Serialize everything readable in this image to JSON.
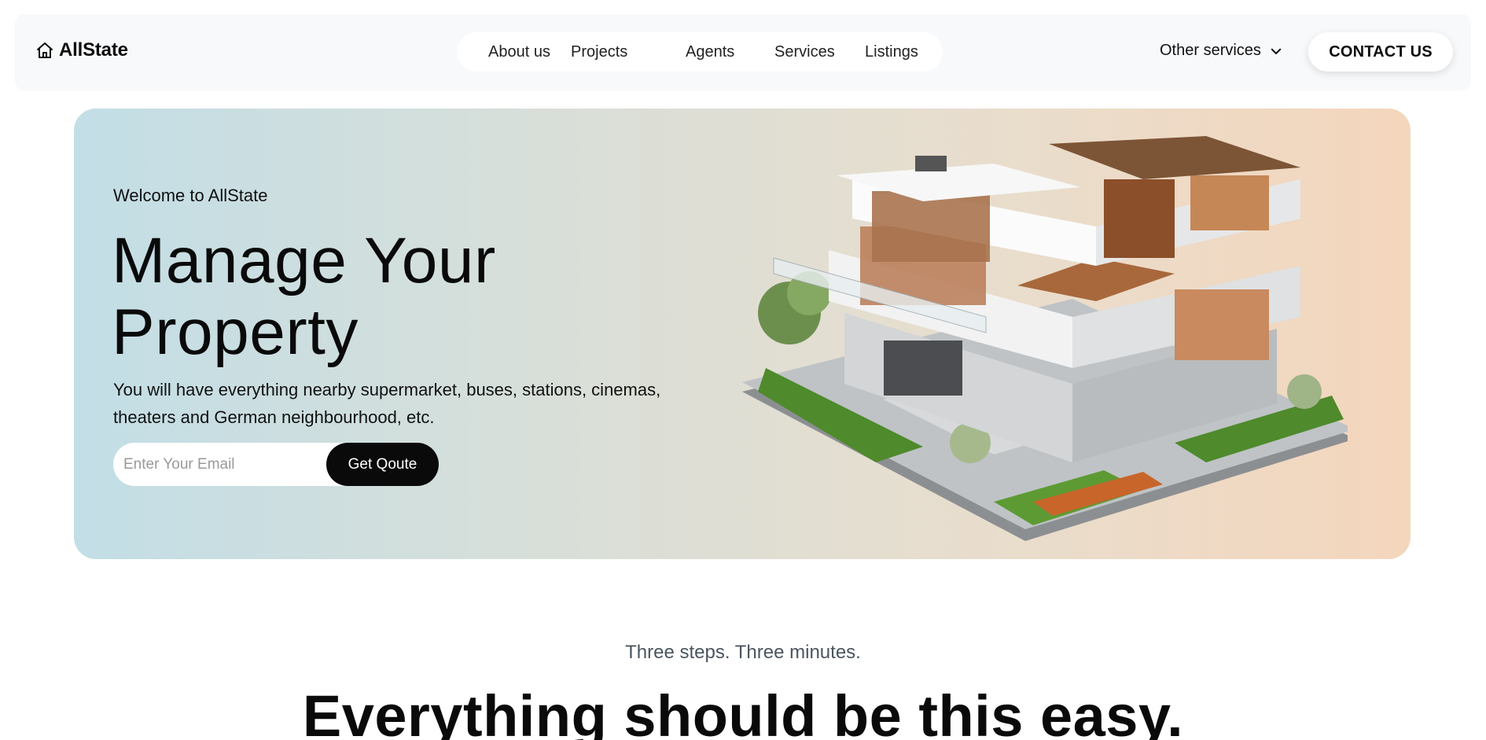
{
  "header": {
    "logo_text": "AllState",
    "logo_icon": "home-icon",
    "nav": [
      "About us",
      "Projects",
      "Agents",
      "Services",
      "Listings"
    ],
    "other_services_label": "Other services",
    "other_services_icon": "chevron-down-icon",
    "contact_label": "CONTACT US"
  },
  "hero": {
    "welcome": "Welcome to AllState",
    "title_line1": "Manage Your",
    "title_line2": "Property",
    "description": "You will have everything nearby supermarket, buses, stations, cinemas, theaters and German neighbourhood, etc.",
    "email_placeholder": "Enter Your Email",
    "cta_label": "Get Qoute",
    "gradient": [
      "#c2dee6",
      "#f4d6bc"
    ]
  },
  "steps": {
    "subtitle": "Three steps. Three minutes.",
    "title": "Everything should be this easy."
  }
}
